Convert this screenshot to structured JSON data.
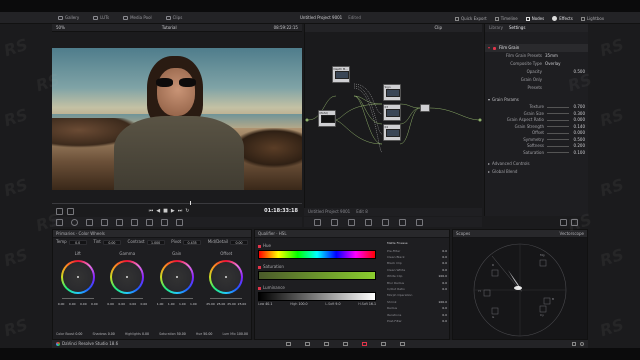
{
  "window": {
    "title": "Untitled Project 9001",
    "edited_label": "Edited"
  },
  "top_tabs": [
    {
      "label": "Gallery",
      "icon": "gallery-icon"
    },
    {
      "label": "LUTs",
      "icon": "luts-icon"
    },
    {
      "label": "Media Pool",
      "icon": "media-pool-icon"
    },
    {
      "label": "Clips",
      "icon": "clips-icon"
    }
  ],
  "top_right": [
    {
      "label": "Quick Export",
      "icon": "export-icon"
    },
    {
      "label": "Timeline",
      "icon": "timeline-icon"
    },
    {
      "label": "Nodes",
      "icon": "nodes-icon"
    },
    {
      "label": "Effects",
      "icon": "effects-icon"
    },
    {
      "label": "Lightbox",
      "icon": "lightbox-icon"
    }
  ],
  "viewer": {
    "zoom": "50%",
    "timeline_name": "Tutorial",
    "timecode_top": "08:59:22:15",
    "timecode": "01:18:33:18"
  },
  "nodes": {
    "mode": "Clip",
    "node_labels": [
      "Depth M...",
      "MASQ",
      "Sign",
      "01",
      "02",
      "03",
      "04",
      "05",
      "06"
    ]
  },
  "settings_panel": {
    "tabs": [
      "Library",
      "Settings"
    ],
    "effect_name": "Film Grain",
    "rows": [
      {
        "label": "Film Grain Presets",
        "value": "35mm"
      },
      {
        "label": "Composite Type",
        "value": "Overlay"
      },
      {
        "label": "Opacity",
        "value": "0.500"
      },
      {
        "label": "Grain Only",
        "value": ""
      },
      {
        "label": "Presets",
        "value": ""
      }
    ],
    "grain_params_title": "Grain Params",
    "grain_rows": [
      {
        "label": "Texture",
        "value": "0.700"
      },
      {
        "label": "Grain Size",
        "value": "0.300"
      },
      {
        "label": "Grain Aspect Ratio",
        "value": "0.000"
      },
      {
        "label": "Grain Strength",
        "value": "0.140"
      },
      {
        "label": "Offset",
        "value": "0.000"
      },
      {
        "label": "Symmetry",
        "value": "0.500"
      },
      {
        "label": "Softness",
        "value": "0.200"
      },
      {
        "label": "Saturation",
        "value": "0.100"
      }
    ],
    "advanced": "Advanced Controls",
    "global": "Global Blend"
  },
  "status_strip": {
    "clip_name": "Untitled Project 9001",
    "extra": "Edit 8"
  },
  "primaries": {
    "title": "Primaries · Color Wheels",
    "top_params": [
      {
        "label": "Temp",
        "value": "0.0"
      },
      {
        "label": "Tint",
        "value": "0.00"
      },
      {
        "label": "Contrast",
        "value": "1.000"
      },
      {
        "label": "Pivot",
        "value": "0.435"
      },
      {
        "label": "Mid/Detail",
        "value": "0.00"
      }
    ],
    "wheels": [
      {
        "name": "Lift",
        "values": [
          "0.00",
          "0.00",
          "0.00",
          "0.00"
        ]
      },
      {
        "name": "Gamma",
        "values": [
          "0.00",
          "0.00",
          "0.00",
          "0.00"
        ]
      },
      {
        "name": "Gain",
        "values": [
          "1.00",
          "1.00",
          "1.00",
          "1.00"
        ]
      },
      {
        "name": "Offset",
        "values": [
          "25.00",
          "25.00",
          "25.00",
          "25.00"
        ]
      }
    ],
    "bottom_params": [
      {
        "label": "Color Boost",
        "value": "0.00"
      },
      {
        "label": "Shadows",
        "value": "0.00"
      },
      {
        "label": "Highlights",
        "value": "0.00"
      },
      {
        "label": "Saturation",
        "value": "50.00"
      },
      {
        "label": "Hue",
        "value": "50.00"
      },
      {
        "label": "Lum Mix",
        "value": "100.00"
      }
    ]
  },
  "qualifier": {
    "title": "Qualifier · HSL",
    "hue_label": "Hue",
    "sat_label": "Saturation",
    "lum_label": "Luminance",
    "lum_values": [
      {
        "label": "Low",
        "value": "40.1"
      },
      {
        "label": "High",
        "value": "100.0"
      },
      {
        "label": "L.Soft",
        "value": "9.0"
      },
      {
        "label": "H.Soft",
        "value": "16.1"
      }
    ],
    "matte_title": "Matte Finesse",
    "matte_rows": [
      {
        "label": "Pre-Filter",
        "value": "0.0"
      },
      {
        "label": "Clean Black",
        "value": "0.0"
      },
      {
        "label": "Black Clip",
        "value": "0.0"
      },
      {
        "label": "Clean White",
        "value": "0.0"
      },
      {
        "label": "White Clip",
        "value": "100.0"
      },
      {
        "label": "Blur Radius",
        "value": "0.0"
      },
      {
        "label": "In/Out Ratio",
        "value": "0.0"
      },
      {
        "label": "Morph Operation",
        "value": ""
      },
      {
        "label": "Shrink",
        "value": "100.0"
      },
      {
        "label": "Radius",
        "value": "0.0"
      },
      {
        "label": "Iterations",
        "value": "0.0"
      },
      {
        "label": "Post-Filter",
        "value": "0.0"
      }
    ]
  },
  "scopes": {
    "title": "Scopes",
    "mode": "Vectorscope",
    "targets": [
      "R",
      "Mg",
      "B",
      "Cy",
      "G",
      "Yl"
    ]
  },
  "app": {
    "name": "DaVinci Resolve Studio 18.6"
  },
  "watermark": "RS",
  "colors": {
    "accent": "#e0344a",
    "bg": "#1b1b1d",
    "panel": "#1e1e21",
    "highlight": "#c0392b"
  }
}
